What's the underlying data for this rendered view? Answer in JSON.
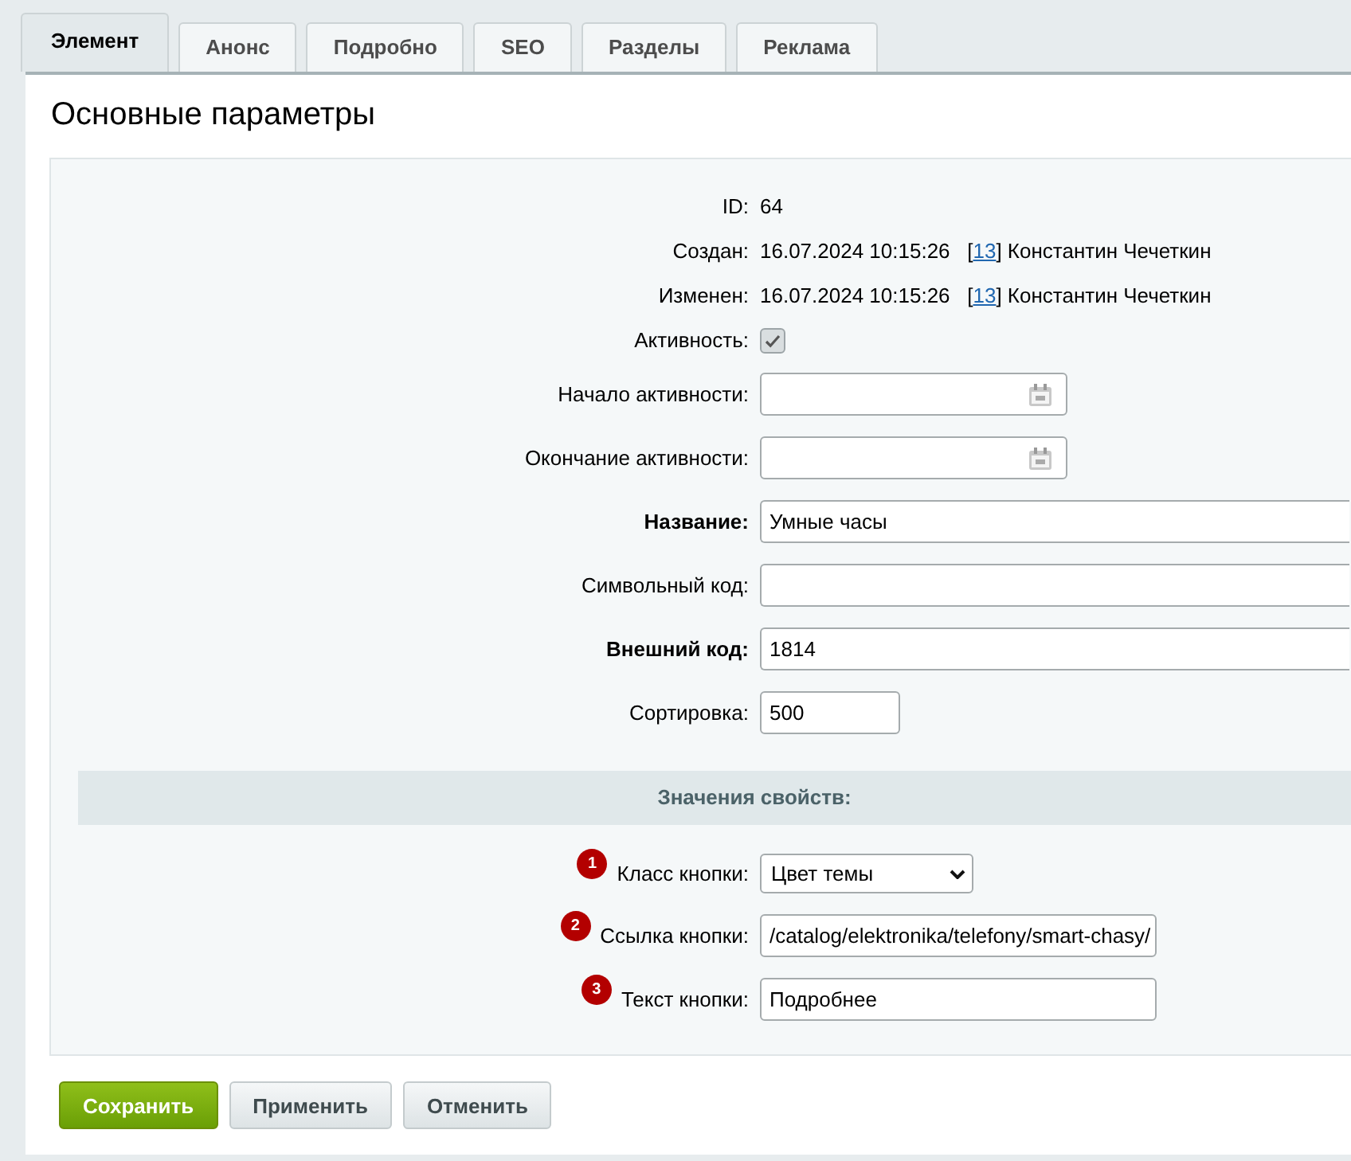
{
  "tabs": [
    {
      "label": "Элемент",
      "selected": true
    },
    {
      "label": "Анонс",
      "selected": false
    },
    {
      "label": "Подробно",
      "selected": false
    },
    {
      "label": "SEO",
      "selected": false
    },
    {
      "label": "Разделы",
      "selected": false
    },
    {
      "label": "Реклама",
      "selected": false
    }
  ],
  "heading": "Основные параметры",
  "fields": [
    {
      "kind": "text",
      "label": "ID:",
      "value": "64"
    },
    {
      "kind": "meta",
      "label": "Создан:",
      "date": "16.07.2024 10:15:26",
      "open": "[",
      "user_id": "13",
      "close": "]",
      "user": "Константин Чечеткин"
    },
    {
      "kind": "meta",
      "label": "Изменен:",
      "date": "16.07.2024 10:15:26",
      "open": "[",
      "user_id": "13",
      "close": "]",
      "user": "Константин Чечеткин"
    },
    {
      "kind": "checkbox",
      "label": "Активность:",
      "checked": true
    },
    {
      "kind": "date",
      "label": "Начало активности:"
    },
    {
      "kind": "date",
      "label": "Окончание активности:"
    },
    {
      "kind": "wideinput",
      "label": "Название:",
      "required": true,
      "value": "Умные часы"
    },
    {
      "kind": "wideinput",
      "label": "Символьный код:",
      "required": false
    },
    {
      "kind": "wideinput",
      "label": "Внешний код:",
      "required": true,
      "value": "1814"
    },
    {
      "kind": "shortinput",
      "label": "Сортировка:",
      "required": false,
      "value": "500"
    }
  ],
  "properties": {
    "title": "Значения свойств:",
    "fields": [
      {
        "badge": "1",
        "kind": "select",
        "label": "Класс кнопки:",
        "value": "Цвет темы"
      },
      {
        "badge": "2",
        "kind": "input",
        "label": "Ссылка кнопки:",
        "value": "/catalog/elektronika/telefony/smart-chasy/"
      },
      {
        "badge": "3",
        "kind": "input",
        "label": "Текст кнопки:",
        "value": "Подробнее"
      }
    ]
  },
  "buttons": [
    {
      "label": "Сохранить",
      "kind": "primary"
    },
    {
      "label": "Применить",
      "kind": "secondary"
    },
    {
      "label": "Отменить",
      "kind": "secondary"
    }
  ]
}
